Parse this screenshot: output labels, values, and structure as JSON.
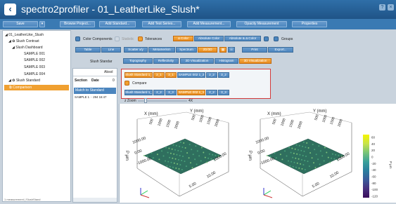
{
  "window": {
    "title": "spectro2profiler - 01_LeatherLike_Slush*",
    "help": "?",
    "close": "×"
  },
  "menu": {
    "save": "Save",
    "browse": "Browse Project...",
    "add_standard": "Add Standard...",
    "add_test": "Add Test Series...",
    "add_measurement": "Add Measurement...",
    "opacity": "Opacity Measurement",
    "properties": "Properties"
  },
  "tree": [
    {
      "label": "01_LeatherLike_Slush"
    },
    {
      "label": "Slush Contrast"
    },
    {
      "label": "Slush Dashboard"
    },
    {
      "label": "SAMPLE 001"
    },
    {
      "label": "SAMPLE 002"
    },
    {
      "label": "SAMPLE 003"
    },
    {
      "label": "SAMPLE 004"
    },
    {
      "label": "Slush Standard"
    },
    {
      "label": "Comparison"
    }
  ],
  "sidebar_status": "1 measurement | SlushStand",
  "toolbar1": {
    "color_components": "Color Components",
    "statistic": "Statistic",
    "tolerances": "Tolerances",
    "delta_color": "Δ Color",
    "absolute_color": "Absolute Color",
    "absolute_delta": "Absolute & Δ Color",
    "groups": "Groups"
  },
  "toolbar2": {
    "table": "Table",
    "line": "Line",
    "scatter": "Scatter x/y",
    "metamerism": "Metamerism",
    "spectrum": "Spectrum",
    "zoom": "2D/3D",
    "print": "Print",
    "export": "Export..."
  },
  "viewtabs": {
    "topography": "Topography",
    "reflectivity": "Reflectivity",
    "vis2d": "2D Visualization",
    "histogram": "Histogram",
    "vis3d": "3D Visualization"
  },
  "list": {
    "header": "Slush Standar",
    "filter_label": "Absol",
    "col1": "Section",
    "col2": "Date",
    "col3": "0",
    "match_header": "Match to Standard",
    "row1": "SAMPLE 1 ·· 294 16:47"
  },
  "compare": {
    "row1": [
      "Slush Standard 1_1",
      "2_1",
      "3_1",
      "SAMPLE 002 1_2",
      "2_2",
      "3_2"
    ],
    "compare_label": "Compare",
    "row2": [
      "Slush Standard 1_1",
      "2_2",
      "3_3",
      "SAMPLE 002 1_1",
      "2_2",
      "3_3"
    ]
  },
  "zoom": {
    "label": "z Zoom",
    "value": "4X"
  },
  "plot": {
    "x_label": "X (mm)",
    "y_label": "Y (mm)",
    "z_label": "P μm",
    "ticks_top": [
      "500",
      "1000",
      "1500",
      "2000"
    ],
    "ticks_y_left": [
      "500",
      "1000"
    ],
    "ticks_x_bottom": [
      "5.00",
      "10.00"
    ],
    "z_ticks": [
      "1000.00",
      "0.00",
      "-1000.00"
    ]
  },
  "legend": {
    "ticks": [
      "60",
      "40",
      "20",
      "0",
      "-20",
      "-40",
      "-60",
      "-80",
      "-100",
      "-120"
    ],
    "unit": "P μm",
    "colors": [
      "#f5f500",
      "#c8e34a",
      "#78c478",
      "#3aa09a",
      "#2a7e9e",
      "#3a5a9a",
      "#46307e",
      "#3a0c5a"
    ]
  }
}
